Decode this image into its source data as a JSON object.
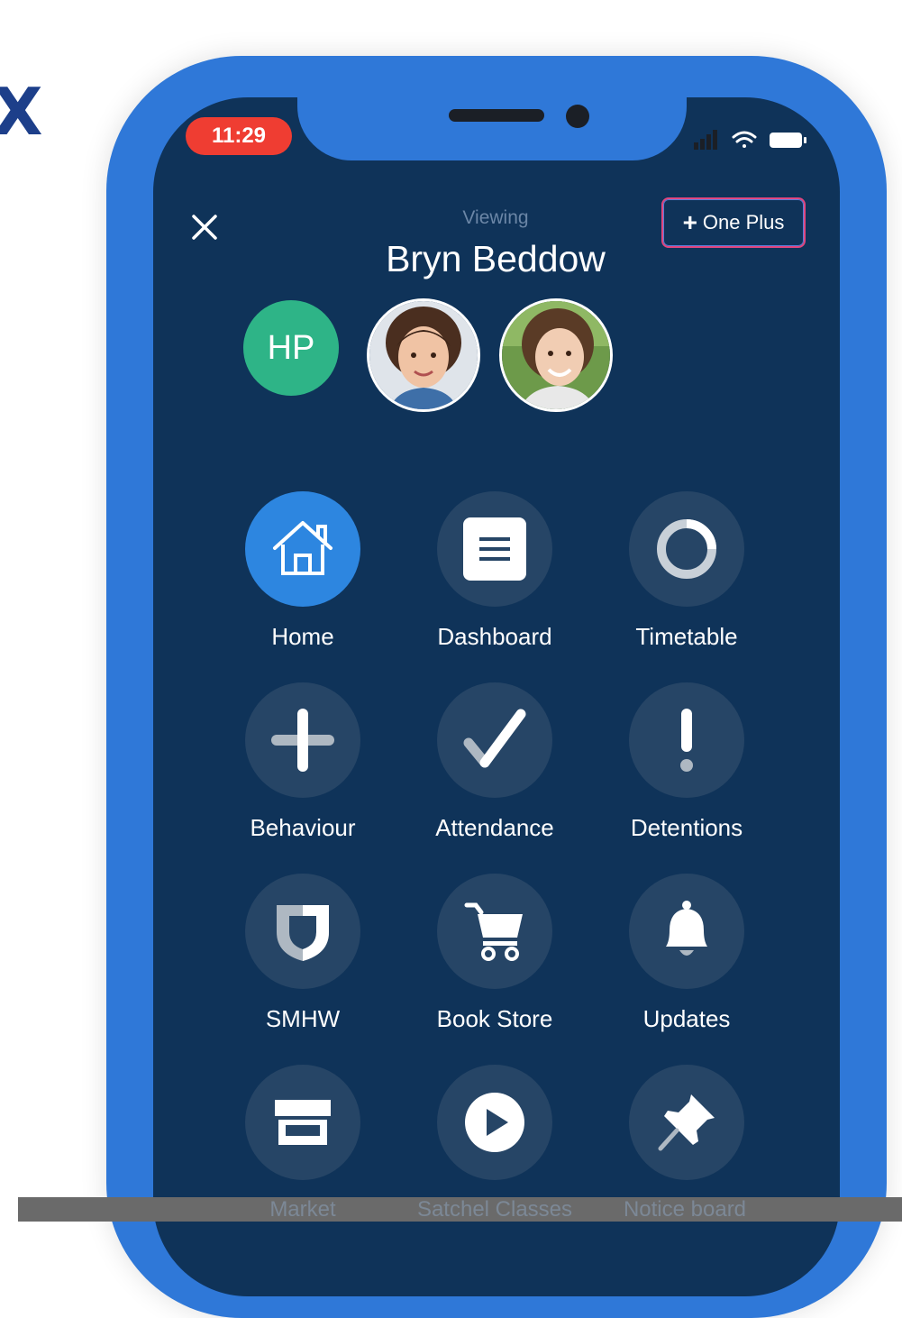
{
  "edge_glyph": "X",
  "status_bar": {
    "time": "11:29"
  },
  "header": {
    "viewing_label": "Viewing",
    "viewing_name": "Bryn Beddow",
    "one_plus_label": "One Plus"
  },
  "profiles": [
    {
      "initials": "HP",
      "color": "#2eb487"
    },
    {
      "type": "photo"
    },
    {
      "type": "photo"
    }
  ],
  "menu": [
    {
      "label": "Home",
      "icon": "home-icon",
      "active": true
    },
    {
      "label": "Dashboard",
      "icon": "document-icon"
    },
    {
      "label": "Timetable",
      "icon": "ring-icon"
    },
    {
      "label": "Behaviour",
      "icon": "plus-icon"
    },
    {
      "label": "Attendance",
      "icon": "checkmark-icon"
    },
    {
      "label": "Detentions",
      "icon": "exclamation-icon"
    },
    {
      "label": "SMHW",
      "icon": "shield-icon"
    },
    {
      "label": "Book Store",
      "icon": "cart-icon"
    },
    {
      "label": "Updates",
      "icon": "bell-icon"
    },
    {
      "label": "Market",
      "icon": "store-icon"
    },
    {
      "label": "Satchel Classes",
      "icon": "play-icon"
    },
    {
      "label": "Notice board",
      "icon": "pin-icon"
    }
  ],
  "colors": {
    "frame": "#2f78d8",
    "screen": "#0f3359",
    "tile": "#264566",
    "active_tile": "#2d86e0",
    "time_pill": "#ef3d32"
  }
}
